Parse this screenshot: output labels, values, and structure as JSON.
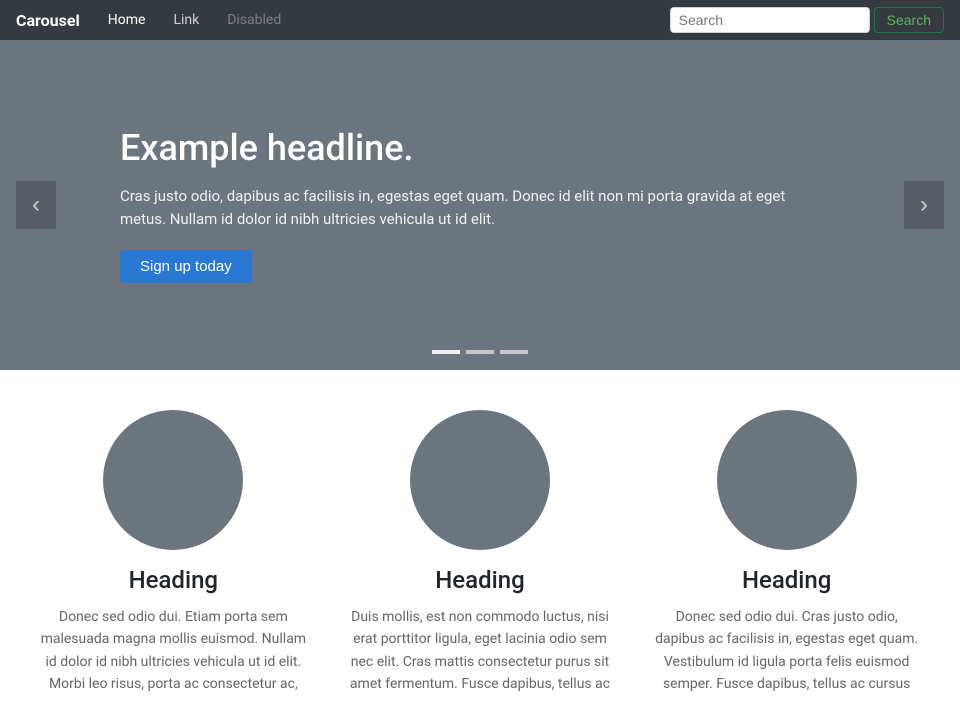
{
  "navbar": {
    "brand": "Carousel",
    "links": [
      {
        "label": "Home",
        "class": "active"
      },
      {
        "label": "Link",
        "class": ""
      },
      {
        "label": "Disabled",
        "class": "disabled"
      }
    ],
    "search_placeholder": "Search",
    "search_btn_label": "Search"
  },
  "carousel": {
    "prev_label": "‹",
    "next_label": "›",
    "headline": "Example headline.",
    "body": "Cras justo odio, dapibus ac facilisis in, egestas eget quam. Donec id elit non mi porta gravida at eget metus. Nullam id dolor id nibh ultricies vehicula ut id elit.",
    "cta_label": "Sign up today",
    "dots": [
      {
        "active": true
      },
      {
        "active": false
      },
      {
        "active": false
      }
    ]
  },
  "columns": [
    {
      "heading": "Heading",
      "text": "Donec sed odio dui. Etiam porta sem malesuada magna mollis euismod. Nullam id dolor id nibh ultricies vehicula ut id elit. Morbi leo risus, porta ac consectetur ac,"
    },
    {
      "heading": "Heading",
      "text": "Duis mollis, est non commodo luctus, nisi erat porttitor ligula, eget lacinia odio sem nec elit. Cras mattis consectetur purus sit amet fermentum. Fusce dapibus, tellus ac"
    },
    {
      "heading": "Heading",
      "text": "Donec sed odio dui. Cras justo odio, dapibus ac facilisis in, egestas eget quam. Vestibulum id ligula porta felis euismod semper. Fusce dapibus, tellus ac cursus"
    }
  ]
}
